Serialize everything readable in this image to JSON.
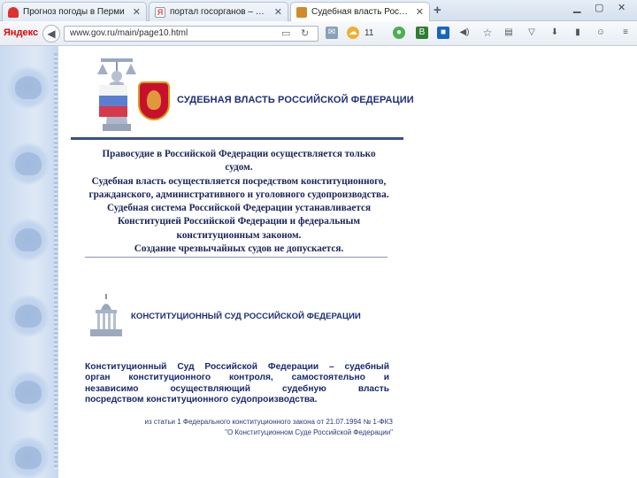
{
  "browser": {
    "tabs": [
      {
        "label": "Прогноз погоды в Перми",
        "active": false
      },
      {
        "label": "портал госорганов – Янд",
        "active": false
      },
      {
        "label": "Судебная власть Россий",
        "active": true
      }
    ],
    "new_tab": "+",
    "brand": "Яндекс",
    "url": "www.gov.ru/main/page10.html",
    "weather_temp": "11"
  },
  "page": {
    "header1_title": "СУДЕБНАЯ ВЛАСТЬ РОССИЙСКОЙ ФЕДЕРАЦИИ",
    "para1_lines": [
      "Правосудие в Российской Федерации осуществляется только",
      "судом.",
      "Судебная власть осуществляется посредством конституционного,",
      "гражданского, административного и уголовного судопроизводства.",
      "Судебная система Российской Федерации устанавливается",
      "Конституцией Российской Федерации и федеральным",
      "конституционным законом.",
      "Создание чрезвычайных судов не допускается."
    ],
    "header2_title": "КОНСТИТУЦИОННЫЙ СУД РОССИЙСКОЙ ФЕДЕРАЦИИ",
    "para2_lines": [
      "Конституционный Суд Российской Федерации – судебный",
      "орган конституционного контроля, самостоятельно и",
      "независимо осуществляющий судебную власть",
      "посредством конституционного судопроизводства."
    ],
    "source_lines": [
      "из статьи 1 Федерального конституционного закона от 21.07.1994 № 1-ФКЗ",
      "\"О Конституционном Суде Российской Федерации\""
    ]
  },
  "colors": {
    "accent": "#1d2f7a",
    "strip": "#c9daf0"
  }
}
